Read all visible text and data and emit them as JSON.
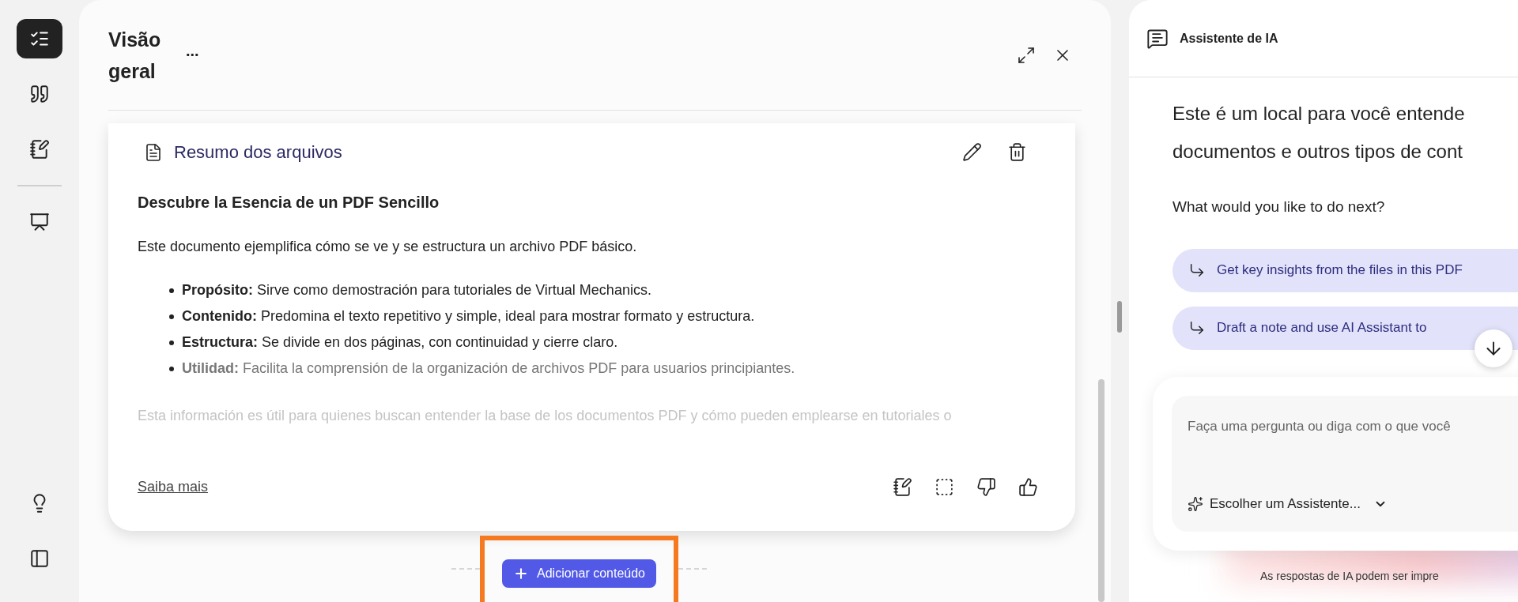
{
  "sidebar": {
    "items": [
      {
        "selected": true
      },
      {
        "selected": false
      },
      {
        "selected": false
      },
      {
        "selected": false
      }
    ],
    "bottom_items": [
      {
        "selected": false
      },
      {
        "selected": false
      }
    ]
  },
  "overview": {
    "title": "Visão geral",
    "more": "...",
    "card": {
      "title": "Resumo dos arquivos",
      "heading": "Descubre la Esencia de un PDF Sencillo",
      "intro": "Este documento ejemplifica cómo se ve y se estructura un archivo PDF básico.",
      "bullets": [
        {
          "text": "**Propósito:** Sirve como demostración para tutoriales de Virtual Mechanics.",
          "faded": false
        },
        {
          "text": "**Contenido:** Predomina el texto repetitivo y simple, ideal para mostrar formato y estructura.",
          "faded": false
        },
        {
          "text": "**Estructura:** Se divide en dos páginas, con continuidad y cierre claro.",
          "faded": false
        },
        {
          "text": "**Utilidad:** Facilita la comprensión de la organización de archivos PDF para usuarios principiantes.",
          "faded": true
        }
      ],
      "closing": {
        "text": "Esta información es útil para quienes buscan entender la base de los documentos PDF y cómo pueden emplearse en tutoriales o",
        "faded": true
      },
      "link": "Saiba mais"
    },
    "add_button": {
      "label": "Adicionar conteúdo",
      "highlighted": true
    }
  },
  "assistant": {
    "title": "Assistente de IA",
    "intro_lines": [
      "Este é um local para você entende",
      "documentos e outros tipos de cont"
    ],
    "question": "What would you like to do next?",
    "suggestions": [
      "Get key insights from the files in this PDF",
      "Draft a note and use AI Assistant to"
    ],
    "input": {
      "placeholder": "Faça uma pergunta ou diga com o que você"
    },
    "picker": "Escolher um Assistente...",
    "disclaimer": "As respostas de IA podem ser impre"
  }
}
